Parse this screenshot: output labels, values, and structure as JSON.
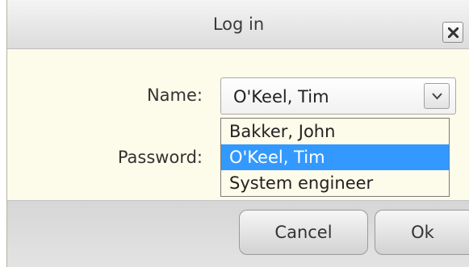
{
  "dialog": {
    "title": "Log in",
    "close_icon": "close-icon"
  },
  "form": {
    "name_label": "Name:",
    "name_value": "O'Keel, Tim",
    "password_label": "Password:",
    "name_options": [
      {
        "label": "Bakker, John",
        "selected": false
      },
      {
        "label": "O'Keel, Tim",
        "selected": true
      },
      {
        "label": "System engineer",
        "selected": false
      }
    ]
  },
  "buttons": {
    "cancel_label": "Cancel",
    "ok_label": "Ok"
  },
  "colors": {
    "dialog_bg": "#fdfbe9",
    "selection": "#3399ff"
  }
}
